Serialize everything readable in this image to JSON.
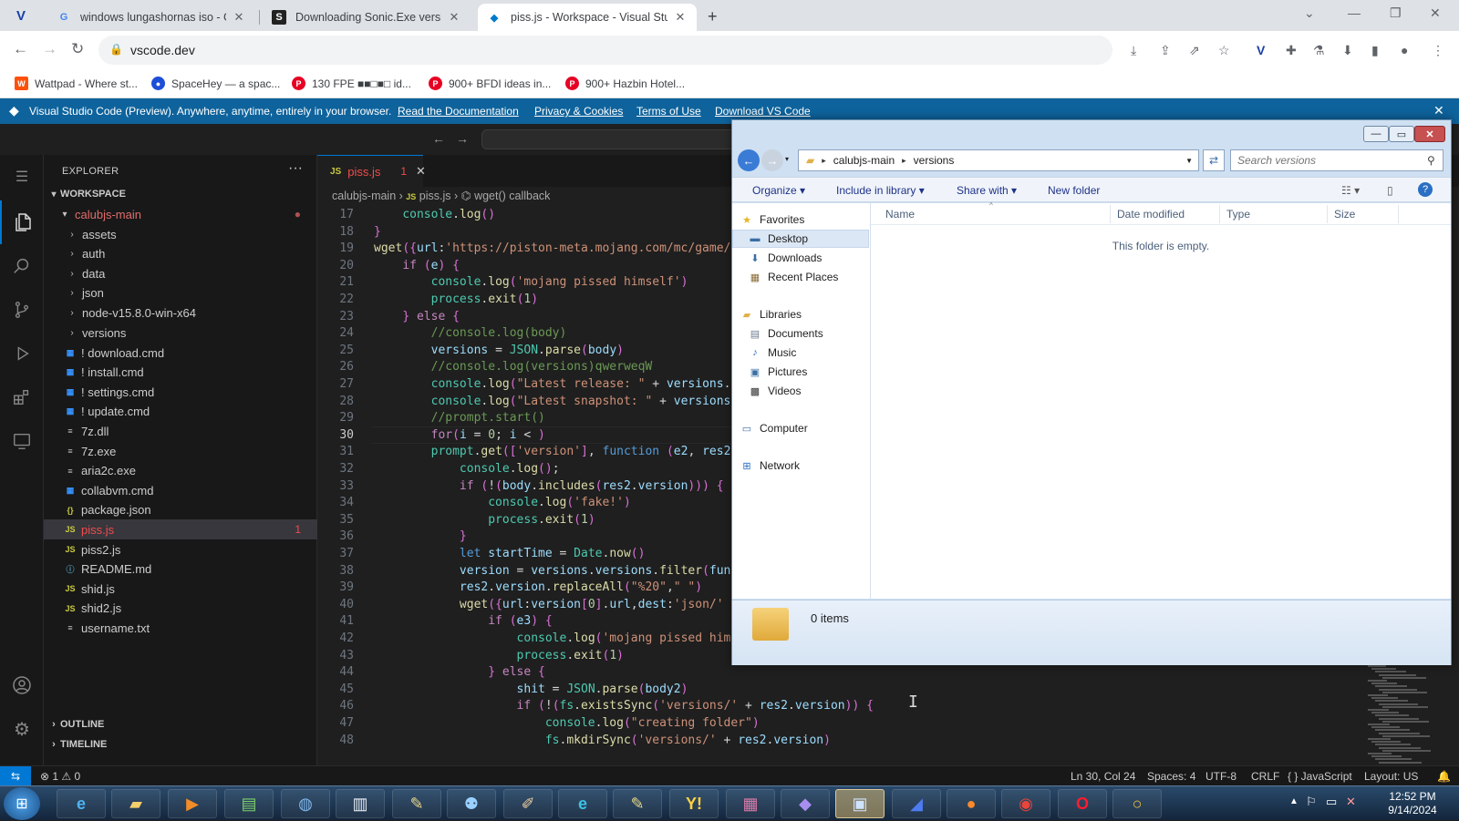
{
  "browser": {
    "tabs": [
      {
        "label": "windows lungashornas iso - Goo",
        "favicon": "google-icon"
      },
      {
        "label": "Downloading Sonic.Exe version",
        "favicon": "sonic-icon"
      },
      {
        "label": "piss.js - Workspace - Visual Stud",
        "favicon": "vscode-icon"
      }
    ],
    "url": "vscode.dev",
    "bookmarks": [
      "Wattpad - Where st...",
      "SpaceHey — a spac...",
      "130 FPE ■■□■□ id...",
      "900+ BFDI ideas in...",
      "900+ Hazbin Hotel..."
    ]
  },
  "banner": {
    "text": "Visual Studio Code (Preview). Anywhere, anytime, entirely in your browser.",
    "links": [
      "Read the Documentation",
      "Privacy & Cookies",
      "Terms of Use",
      "Download VS Code"
    ]
  },
  "sidebar": {
    "title": "EXPLORER",
    "workspace": "WORKSPACE",
    "root": "calubjs-main",
    "folders": [
      "assets",
      "auth",
      "data",
      "json",
      "node-v15.8.0-win-x64",
      "versions"
    ],
    "files": [
      {
        "name": "! download.cmd",
        "icon": "cmd-icon"
      },
      {
        "name": "! install.cmd",
        "icon": "cmd-icon"
      },
      {
        "name": "! settings.cmd",
        "icon": "cmd-icon"
      },
      {
        "name": "! update.cmd",
        "icon": "cmd-icon"
      },
      {
        "name": "7z.dll",
        "icon": "text-file-icon"
      },
      {
        "name": "7z.exe",
        "icon": "text-file-icon"
      },
      {
        "name": "aria2c.exe",
        "icon": "text-file-icon"
      },
      {
        "name": "collabvm.cmd",
        "icon": "cmd-icon"
      },
      {
        "name": "package.json",
        "icon": "json-icon"
      },
      {
        "name": "piss.js",
        "icon": "js-icon",
        "badge": "1",
        "selected": true
      },
      {
        "name": "piss2.js",
        "icon": "js-icon"
      },
      {
        "name": "README.md",
        "icon": "info-icon"
      },
      {
        "name": "shid.js",
        "icon": "js-icon"
      },
      {
        "name": "shid2.js",
        "icon": "js-icon"
      },
      {
        "name": "username.txt",
        "icon": "text-file-icon"
      }
    ],
    "outline": "OUTLINE",
    "timeline": "TIMELINE"
  },
  "editor": {
    "tab": {
      "label": "piss.js",
      "problems": "1"
    },
    "breadcrumbs": [
      "calubjs-main",
      "piss.js",
      "wget() callback"
    ],
    "current_line": 30,
    "lines": [
      {
        "n": 17,
        "indent": 4,
        "text": "console.log()"
      },
      {
        "n": 18,
        "indent": 0,
        "text": "}"
      },
      {
        "n": 19,
        "indent": 0,
        "text": "wget({url:'https://piston-meta.mojang.com/mc/game/"
      },
      {
        "n": 20,
        "indent": 4,
        "text": "if (e) {"
      },
      {
        "n": 21,
        "indent": 8,
        "text": "console.log('mojang pissed himself')"
      },
      {
        "n": 22,
        "indent": 8,
        "text": "process.exit(1)"
      },
      {
        "n": 23,
        "indent": 4,
        "text": "} else {"
      },
      {
        "n": 24,
        "indent": 8,
        "text": "//console.log(body)"
      },
      {
        "n": 25,
        "indent": 8,
        "text": "versions = JSON.parse(body)"
      },
      {
        "n": 26,
        "indent": 8,
        "text": "//console.log(versions)qwerweqW"
      },
      {
        "n": 27,
        "indent": 8,
        "text": "console.log(\"Latest release: \" + versions."
      },
      {
        "n": 28,
        "indent": 8,
        "text": "console.log(\"Latest snapshot: \" + versions"
      },
      {
        "n": 29,
        "indent": 8,
        "text": "//prompt.start()"
      },
      {
        "n": 30,
        "indent": 8,
        "text": "for(i = 0; i < )"
      },
      {
        "n": 31,
        "indent": 8,
        "text": "prompt.get(['version'], function (e2, res2"
      },
      {
        "n": 32,
        "indent": 12,
        "text": "console.log();"
      },
      {
        "n": 33,
        "indent": 12,
        "text": "if (!(body.includes(res2.version))) {"
      },
      {
        "n": 34,
        "indent": 16,
        "text": "console.log('fake!')"
      },
      {
        "n": 35,
        "indent": 16,
        "text": "process.exit(1)"
      },
      {
        "n": 36,
        "indent": 12,
        "text": "}"
      },
      {
        "n": 37,
        "indent": 12,
        "text": "let startTime = Date.now()"
      },
      {
        "n": 38,
        "indent": 12,
        "text": "version = versions.versions.filter(fun"
      },
      {
        "n": 39,
        "indent": 12,
        "text": "res2.version.replaceAll(\"%20\",\" \")"
      },
      {
        "n": 40,
        "indent": 12,
        "text": "wget({url:version[0].url,dest:'json/'"
      },
      {
        "n": 41,
        "indent": 16,
        "text": "if (e3) {"
      },
      {
        "n": 42,
        "indent": 20,
        "text": "console.log('mojang pissed him"
      },
      {
        "n": 43,
        "indent": 20,
        "text": "process.exit(1)"
      },
      {
        "n": 44,
        "indent": 16,
        "text": "} else {"
      },
      {
        "n": 45,
        "indent": 20,
        "text": "shit = JSON.parse(body2)"
      },
      {
        "n": 46,
        "indent": 20,
        "text": "if (!(fs.existsSync('versions/' + res2.version)) {"
      },
      {
        "n": 47,
        "indent": 24,
        "text": "console.log(\"creating folder\")"
      },
      {
        "n": 48,
        "indent": 24,
        "text": "fs.mkdirSync('versions/' + res2.version)"
      }
    ]
  },
  "statusbar": {
    "problems": "⊗ 1 ⚠ 0",
    "position": "Ln 30, Col 24",
    "spaces": "Spaces: 4",
    "encoding": "UTF-8",
    "eol": "CRLF",
    "language": "{ } JavaScript",
    "layout": "Layout: US"
  },
  "explorer": {
    "path": [
      "calubjs-main",
      "versions"
    ],
    "search_placeholder": "Search versions",
    "commands": [
      "Organize ▾",
      "Include in library ▾",
      "Share with ▾",
      "New folder"
    ],
    "nav": {
      "favorites": "Favorites",
      "favorite_items": [
        "Desktop",
        "Downloads",
        "Recent Places"
      ],
      "libraries": "Libraries",
      "library_items": [
        "Documents",
        "Music",
        "Pictures",
        "Videos"
      ],
      "computer": "Computer",
      "network": "Network"
    },
    "columns": [
      "Name",
      "Date modified",
      "Type",
      "Size"
    ],
    "empty_text": "This folder is empty.",
    "item_count": "0 items"
  },
  "taskbar": {
    "time": "12:52 PM",
    "date": "9/14/2024"
  },
  "colors": {
    "accent": "#0078d4",
    "banner": "#0e639c",
    "error": "#f14c4c"
  }
}
